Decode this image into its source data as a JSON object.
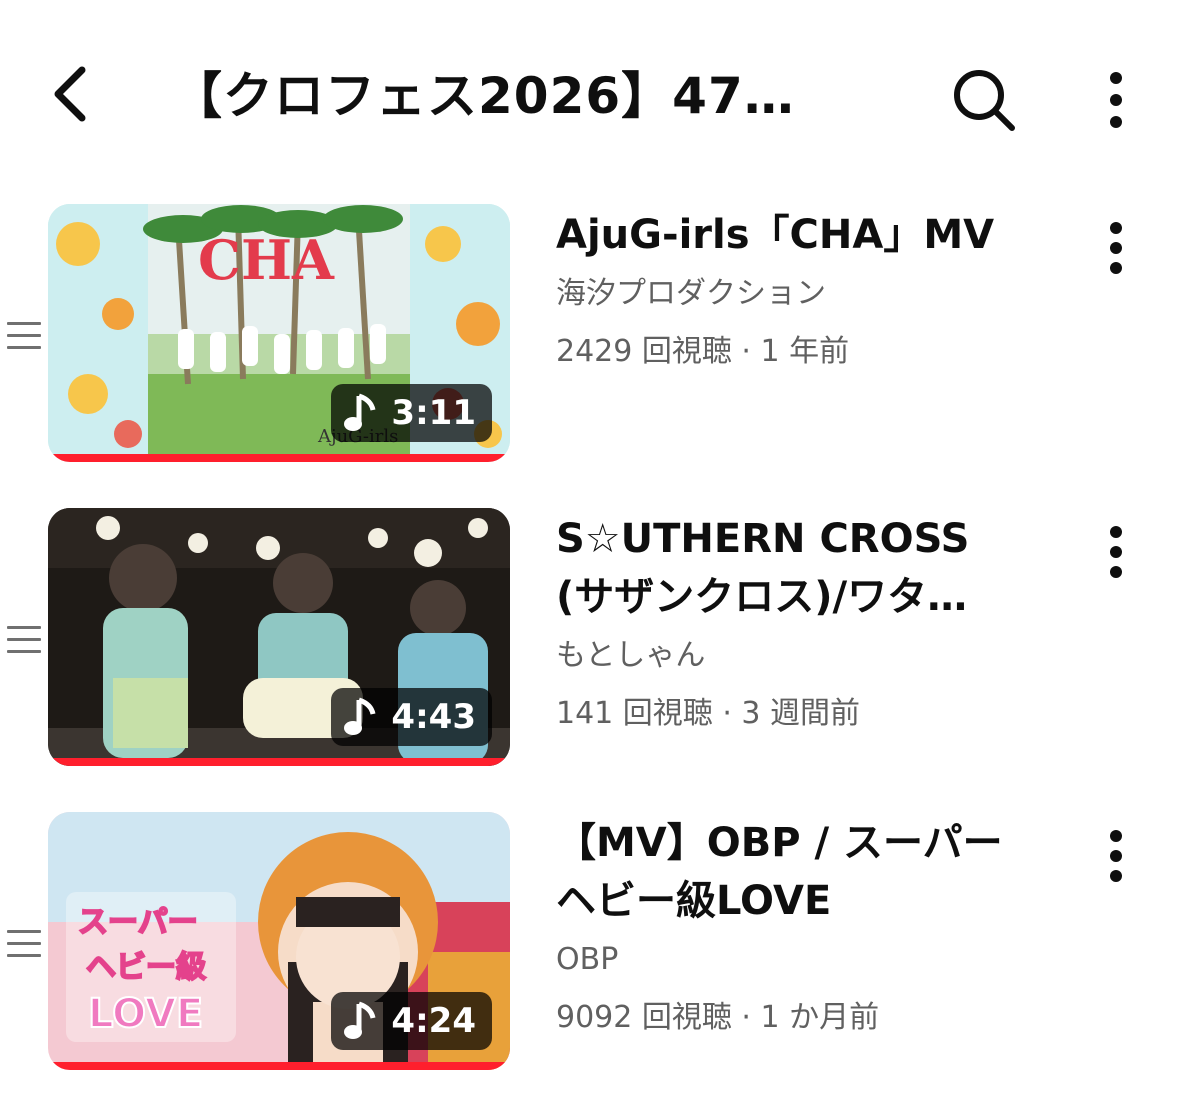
{
  "header": {
    "title": "【クロフェス2026】47…",
    "back_icon": "chevron-left-icon",
    "search_icon": "search-icon",
    "menu_icon": "more-vert-icon"
  },
  "colors": {
    "progress": "#ff1f2d",
    "secondary_text": "#606060"
  },
  "videos": [
    {
      "title": "AjuG-irls「CHA」MV",
      "channel": "海汐プロダクション",
      "meta": "2429 回視聴 · 1 年前",
      "duration": "3:11",
      "thumb_text": "CHA",
      "thumb_watermark": "AjuG-irls",
      "watch_progress": 1.0
    },
    {
      "title": "S☆UTHERN CROSS (サザンクロス)/ワタ…",
      "channel": "もとしゃん",
      "meta": "141 回視聴 · 3 週間前",
      "duration": "4:43",
      "watch_progress": 1.0
    },
    {
      "title": "【MV】OBP / スーパーヘビー級LOVE",
      "channel": "OBP",
      "meta": "9092 回視聴 · 1 か月前",
      "duration": "4:24",
      "thumb_text_lines": [
        "スーパー",
        "ヘビー級",
        "LOVE"
      ],
      "watch_progress": 1.0
    }
  ]
}
